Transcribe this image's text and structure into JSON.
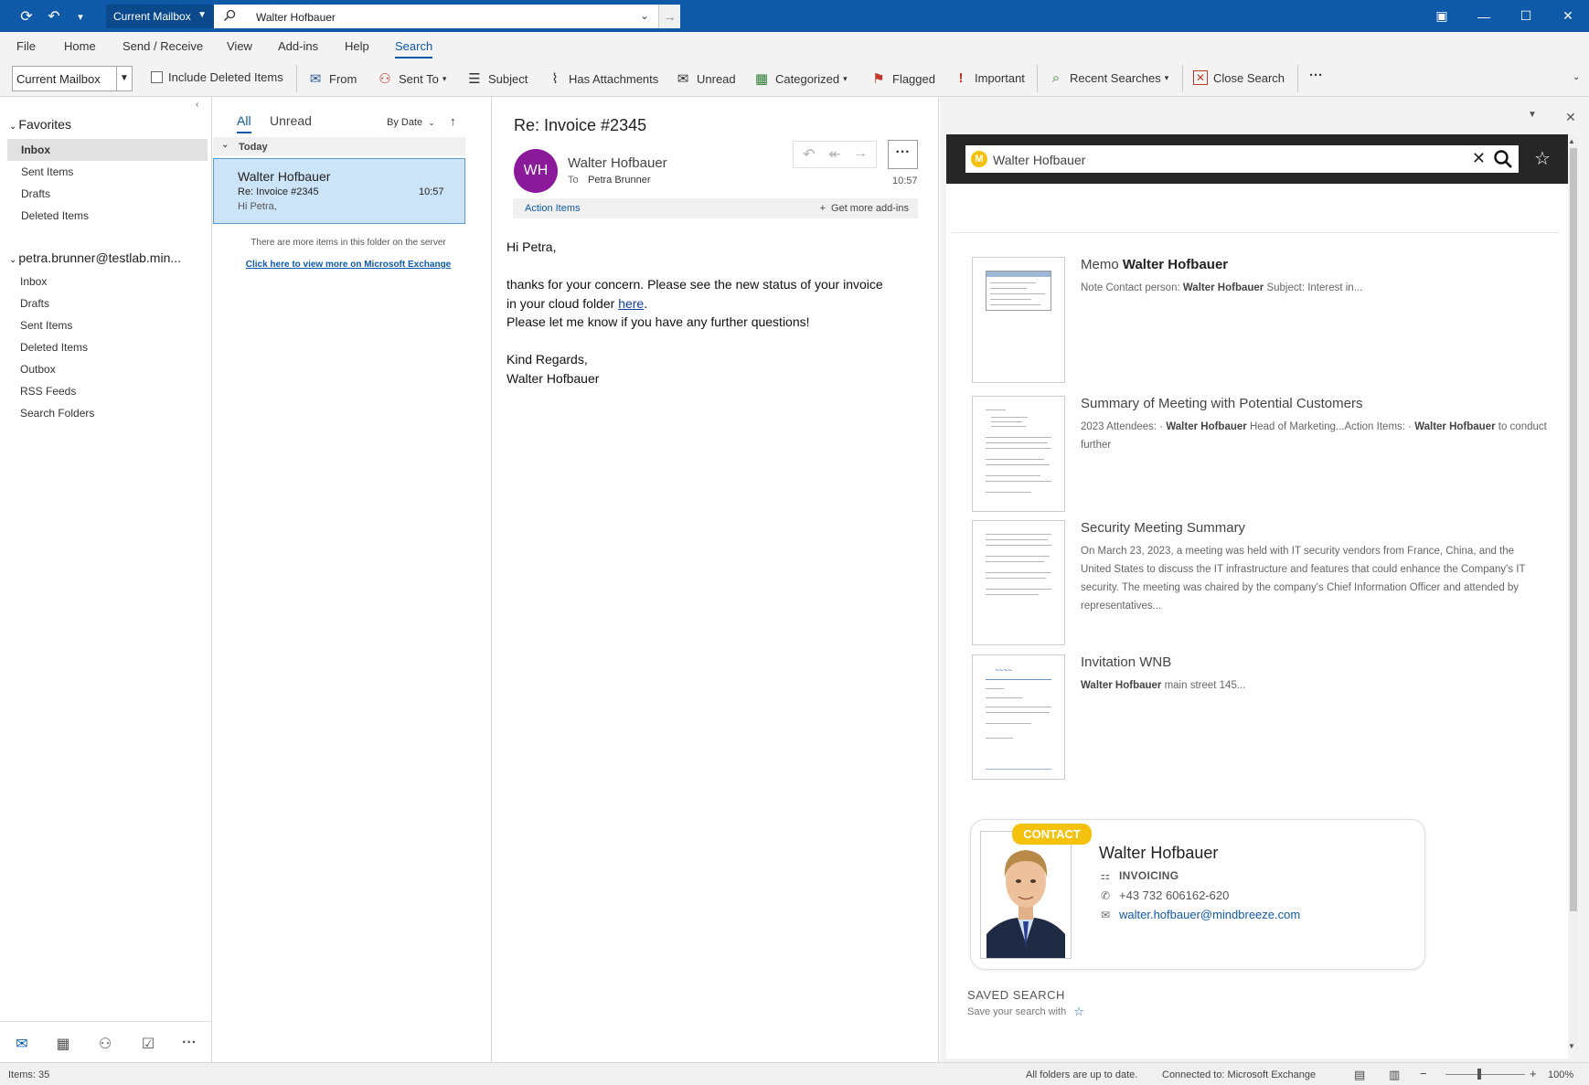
{
  "titlebar": {
    "scope": "Current Mailbox",
    "search_query": "Walter Hofbauer"
  },
  "tabs": [
    {
      "label": "File"
    },
    {
      "label": "Home"
    },
    {
      "label": "Send / Receive"
    },
    {
      "label": "View"
    },
    {
      "label": "Add-ins"
    },
    {
      "label": "Help"
    },
    {
      "label": "Search"
    }
  ],
  "ribbon": {
    "scope": "Current Mailbox",
    "include_deleted": "Include Deleted Items",
    "from": "From",
    "sent_to": "Sent To",
    "subject": "Subject",
    "has_attachments": "Has Attachments",
    "unread": "Unread",
    "categorized": "Categorized",
    "flagged": "Flagged",
    "important": "Important",
    "recent_searches": "Recent Searches",
    "close_search": "Close Search",
    "more": "···"
  },
  "folders": {
    "favorites_header": "Favorites",
    "favorites": [
      {
        "label": "Inbox"
      },
      {
        "label": "Sent Items"
      },
      {
        "label": "Drafts"
      },
      {
        "label": "Deleted Items"
      }
    ],
    "account_header": "petra.brunner@testlab.min...",
    "account_items": [
      {
        "label": "Inbox"
      },
      {
        "label": "Drafts"
      },
      {
        "label": "Sent Items"
      },
      {
        "label": "Deleted Items"
      },
      {
        "label": "Outbox"
      },
      {
        "label": "RSS Feeds"
      },
      {
        "label": "Search Folders"
      }
    ]
  },
  "message_list": {
    "filter_all": "All",
    "filter_unread": "Unread",
    "sort": "By Date",
    "group": "Today",
    "items": [
      {
        "from": "Walter Hofbauer",
        "subject": "Re: Invoice #2345",
        "time": "10:57",
        "preview": "Hi Petra,"
      }
    ],
    "more_note": "There are more items in this folder on the server",
    "more_link": "Click here to view more on Microsoft Exchange"
  },
  "reading": {
    "subject": "Re: Invoice #2345",
    "avatar": "WH",
    "from": "Walter Hofbauer",
    "to_label": "To",
    "to": "Petra Brunner",
    "time": "10:57",
    "action_items": "Action Items",
    "get_addins": "Get more add-ins",
    "body": {
      "greeting": "Hi Petra,",
      "line1": "thanks for your concern. Please see the new status of your invoice",
      "line2_pre": "in your cloud folder ",
      "link": "here",
      "line2_post": ".",
      "line3": "Please let me know if you have any further questions!",
      "closing": "Kind Regards,",
      "signature": "Walter Hofbauer"
    }
  },
  "addin": {
    "query": "Walter Hofbauer",
    "results": [
      {
        "title_pre": "Memo ",
        "title_bold": "Walter Hofbauer",
        "snippet_html": "Note Contact person: <b>Walter Hofbauer</b> Subject: Interest in..."
      },
      {
        "title_pre": "Summary of Meeting with Potential Customers",
        "title_bold": "",
        "snippet_html": "2023 Attendees: · <b>Walter Hofbauer</b> Head of Marketing...Action Items: · <b>Walter Hofbauer</b> to conduct further"
      },
      {
        "title_pre": "Security Meeting Summary",
        "title_bold": "",
        "snippet_html": "On March 23, 2023, a meeting was held with IT security vendors from France, China, and the United States to discuss the IT infrastructure and features that could enhance the Company's IT security. The meeting was chaired by the company's Chief Information Officer and attended by representatives..."
      },
      {
        "title_pre": "Invitation WNB",
        "title_bold": "",
        "snippet_html": "<b>Walter Hofbauer</b> main street 145..."
      }
    ],
    "contact": {
      "badge": "CONTACT",
      "name": "Walter Hofbauer",
      "department": "INVOICING",
      "phone": "+43 732 606162-620",
      "email": "walter.hofbauer@mindbreeze.com"
    },
    "saved_search_label": "SAVED SEARCH",
    "saved_search_hint": "Save your search with"
  },
  "status": {
    "items": "Items: 35",
    "sync": "All folders are up to date.",
    "connection": "Connected to: Microsoft Exchange",
    "zoom": "100%"
  },
  "colors": {
    "accent": "#0f5aa8",
    "avatar": "#8b1a9a",
    "badge": "#f4c20d",
    "selection": "#cce4f7"
  }
}
